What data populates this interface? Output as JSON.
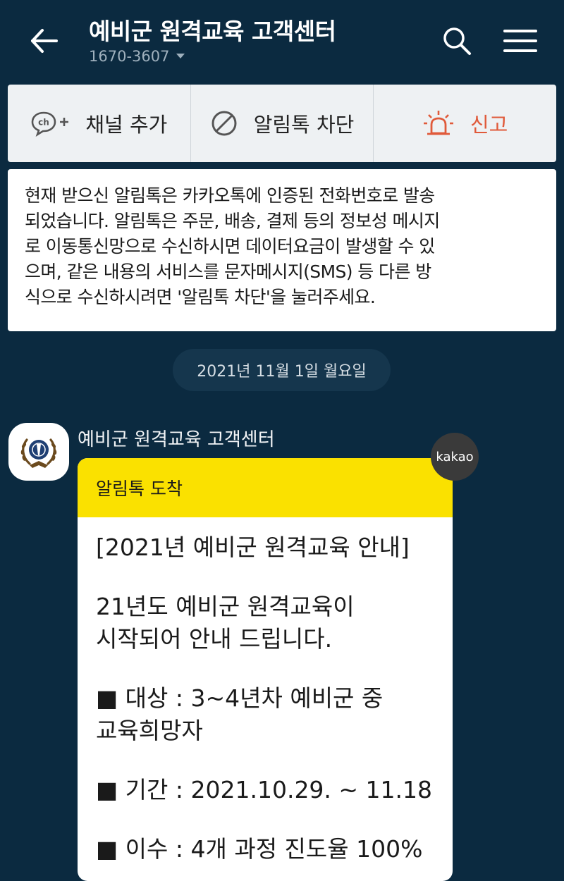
{
  "header": {
    "title": "예비군 원격교육 고객센터",
    "phone": "1670-3607"
  },
  "actions": {
    "add_channel": "채널 추가",
    "block": "알림톡 차단",
    "report": "신고"
  },
  "notice": {
    "lines": [
      "현재 받으신 알림톡은 카카오톡에 인증된 전화번호로 발송",
      "되었습니다. 알림톡은 주문, 배송, 결제 등의 정보성 메시지",
      "로 이동통신망으로 수신하시면 데이터요금이 발생할 수 있",
      "으며, 같은 내용의 서비스를 문자메시지(SMS) 등 다른 방",
      "식으로 수신하시려면 '알림톡 차단'을 눌러주세요."
    ]
  },
  "date_divider": "2021년 11월 1일 월요일",
  "message": {
    "sender": "예비군 원격교육 고객센터",
    "badge": "kakao",
    "bubble_header": "알림톡 도착",
    "body": {
      "title": "[2021년 예비군 원격교육 안내]",
      "intro_1": "21년도 예비군 원격교육이",
      "intro_2": "시작되어 안내 드립니다.",
      "target_1": "■ 대상 : 3~4년차 예비군 중",
      "target_2": "교육희망자",
      "period": "■ 기간 : 2021.10.29. ~ 11.18",
      "completion": "■ 이수 : 4개 과정 진도율 100%"
    }
  },
  "colors": {
    "background": "#0b2a40",
    "accent_yellow": "#fae100",
    "report_red": "#e05a3a"
  },
  "icons": {
    "back": "arrow-left-icon",
    "search": "search-icon",
    "menu": "hamburger-menu-icon",
    "add_channel": "channel-add-icon",
    "block": "block-icon",
    "report": "siren-icon"
  }
}
